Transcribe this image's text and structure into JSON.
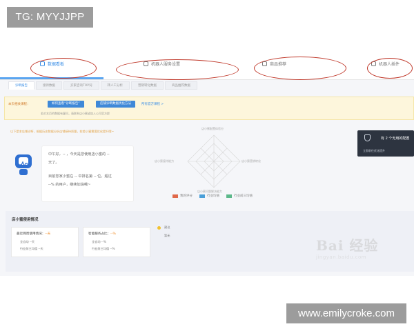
{
  "watermark_top": "TG: MYYJJPP",
  "watermark_bottom": "www.emilycroke.com",
  "nav": {
    "tabs": [
      {
        "label": "数据看板",
        "icon": "dashboard-icon",
        "active": true
      },
      {
        "label": "机器人服务设置",
        "icon": "gear-icon",
        "active": false
      },
      {
        "label": "商品推荐",
        "icon": "goods-icon",
        "active": false
      },
      {
        "label": "机器人插件",
        "icon": "plugin-icon",
        "active": false
      }
    ]
  },
  "subtabs": [
    "诊断报告",
    "接待数据",
    "买家咨询TOP词",
    "转人工分析",
    "营销转化数据",
    "商品推荐数据"
  ],
  "notice": {
    "label": "本页相关课程：",
    "btn1": "如何查看“诊断报告”",
    "btn2": "店铺诊断数据优化方法",
    "link": "所有官方课程 >",
    "sub": "若对本页的数据有疑问，请联系店小蜜或加入公司官方群"
  },
  "hint": "以下是本店铺诊断，根据历史数据分析店铺接待质量，较差小蜜需要优化提升哦~",
  "bubble": {
    "line1": "中午好，-- ，今天是您使用店小蜜的 --",
    "line2": "天了。",
    "line3": "目前您家小蜜在 -- 中排名第 -- 位，超过",
    "line4": "--% 的用户，继续加油哦~"
  },
  "radar": {
    "top": "店小蜜配置体验分",
    "left": "店小蜜接待能力",
    "right": "店小蜜营销转化",
    "bottom": "店小蜜问题解决能力"
  },
  "legend": [
    {
      "label": "我的评分",
      "color": "#e0694a"
    },
    {
      "label": "行业均值",
      "color": "#4a9fd8"
    },
    {
      "label": "行业前三均值",
      "color": "#5cb88a"
    }
  ],
  "tooltip": {
    "title": "有 2 个无用的配置",
    "sub": "立即前往优化提升"
  },
  "store": {
    "title": "店小蜜使用情况",
    "card1": {
      "title": "最近两周使用情况：",
      "value": "--天",
      "rows": [
        "全自动 --天",
        "行业前三均值 --天"
      ]
    },
    "card2": {
      "title": "智能服务占比：",
      "value": "--%",
      "rows": [
        "全自动 --%",
        "行业前三均值 --%"
      ]
    },
    "badge_label1": "建议",
    "badge_label2": "暂无"
  },
  "baidu": {
    "logo": "Bai 经验",
    "url": "jingyan.baidu.com"
  }
}
